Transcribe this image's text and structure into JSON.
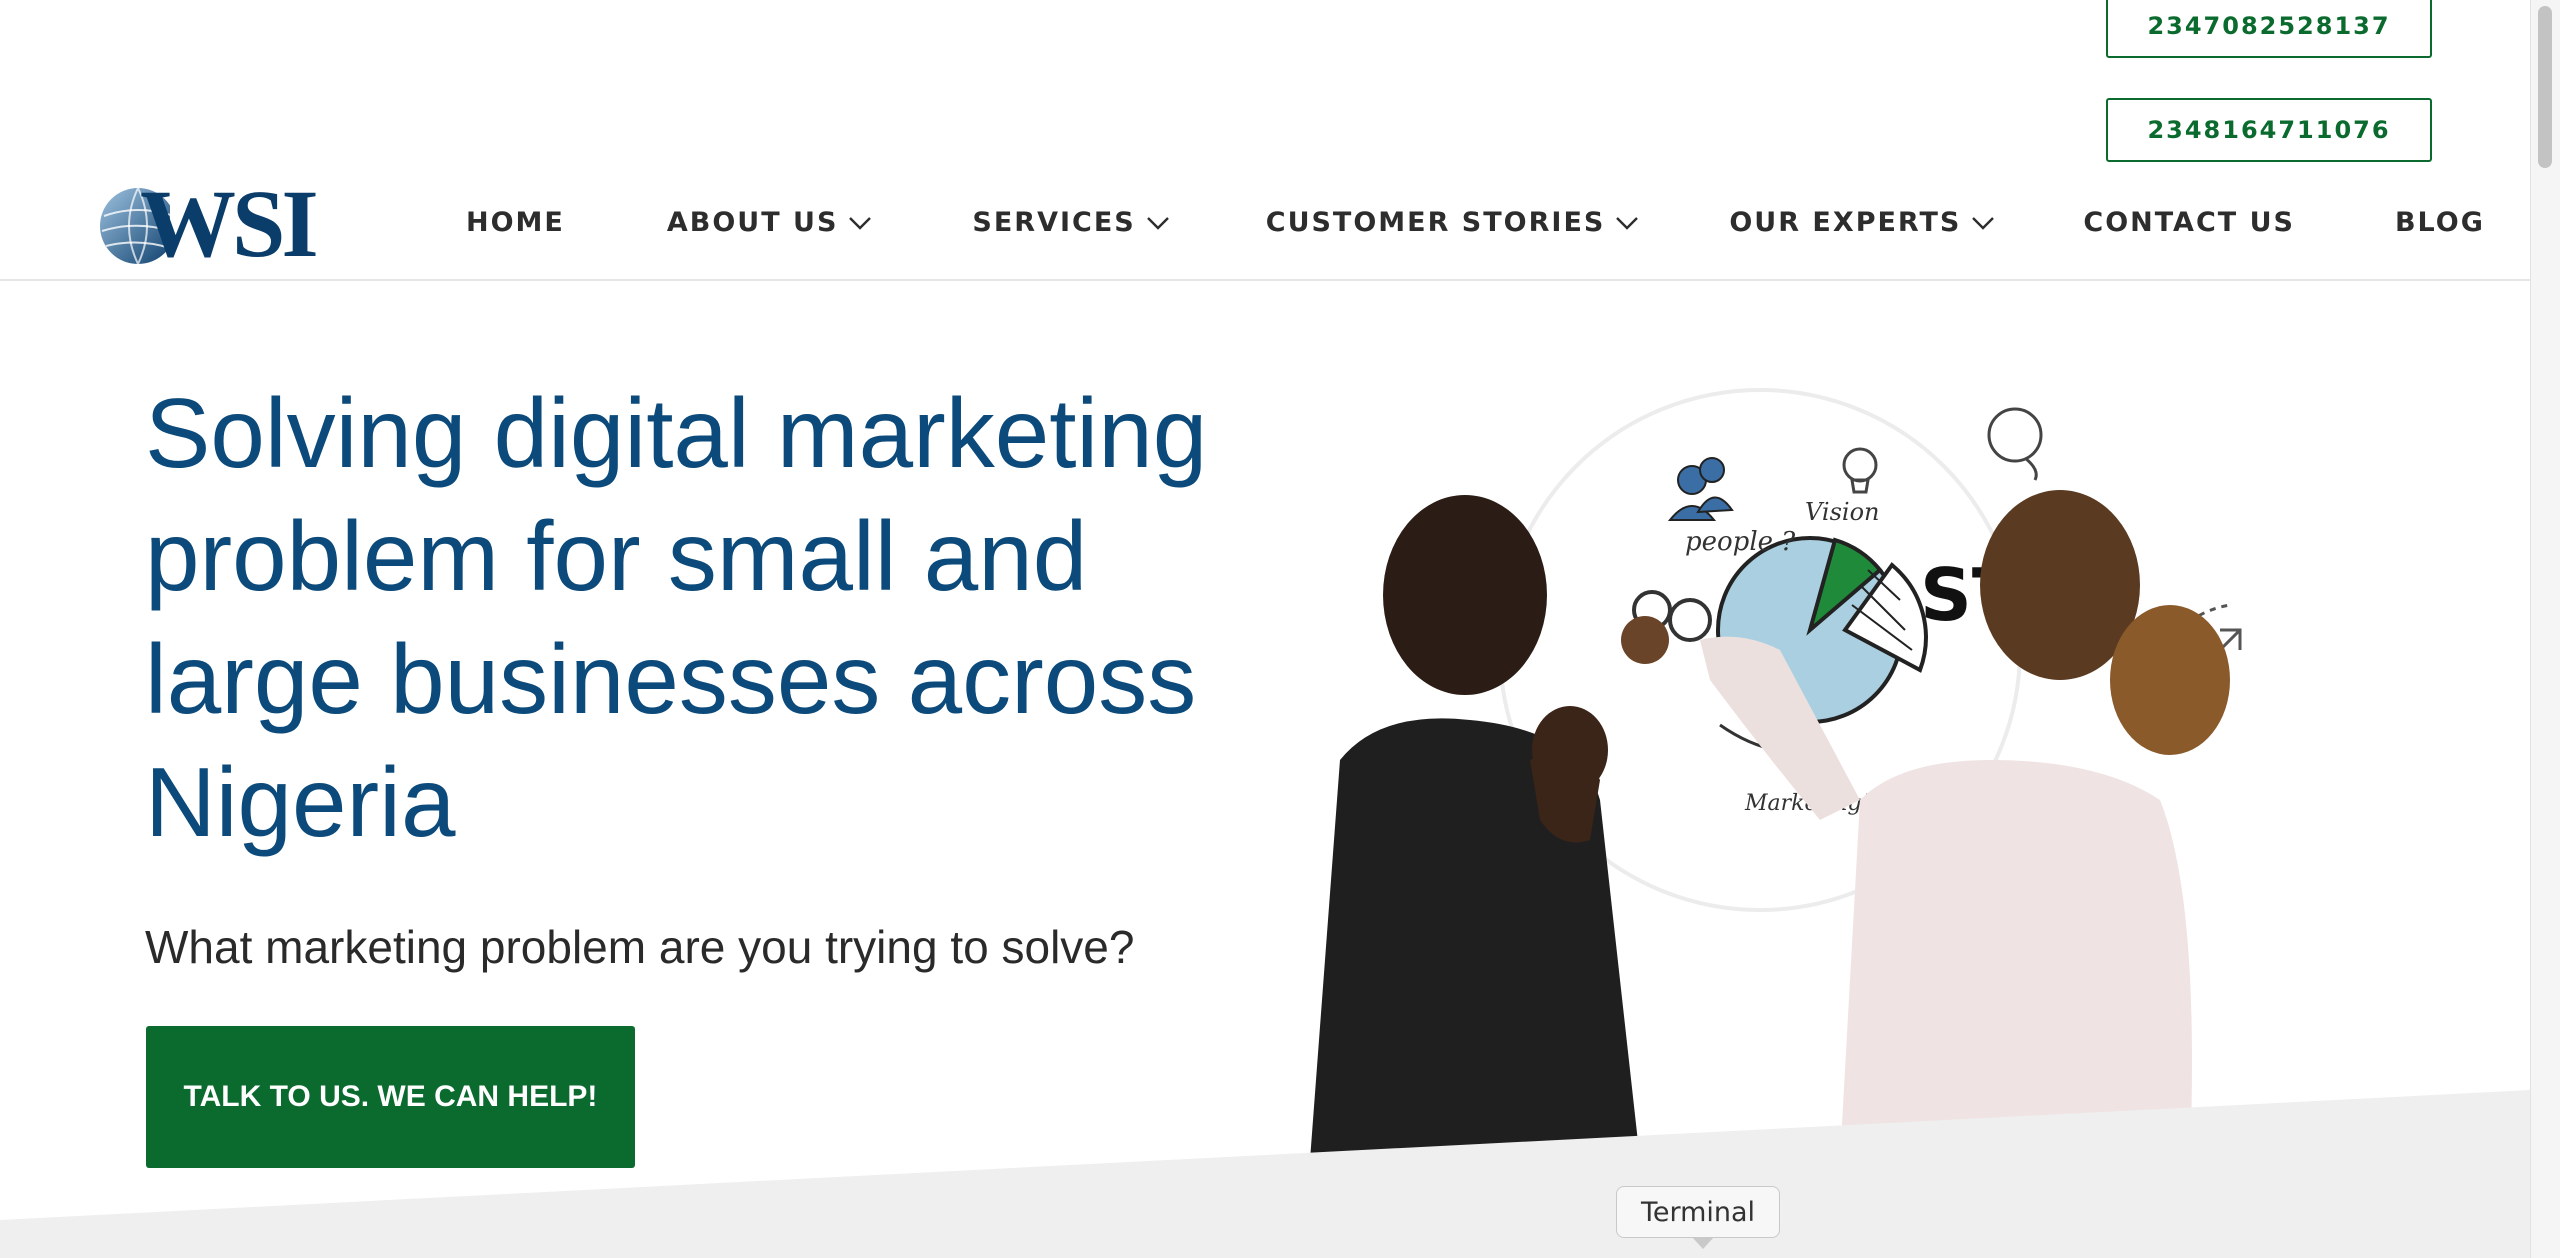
{
  "contact_buttons": [
    "2347082528137",
    "2348164711076"
  ],
  "header": {
    "logo_text": "WSI",
    "nav": {
      "home": "HOME",
      "about": "ABOUT US",
      "services": "SERVICES",
      "stories": "CUSTOMER STORIES",
      "experts": "OUR EXPERTS",
      "contact": "CONTACT US",
      "blog": "BLOG"
    }
  },
  "hero": {
    "headline": "Solving digital marketing problem for small and large businesses across Nigeria",
    "subheadline": "What marketing problem are you trying to solve?",
    "cta_label": "TALK TO US. WE CAN HELP!",
    "illustration_words": {
      "people": "people ?",
      "vision": "Vision",
      "strategy": "ST",
      "marketing": "Marketing!"
    }
  },
  "tooltip": {
    "label": "Terminal"
  },
  "colors": {
    "brand_blue": "#0b4a7a",
    "brand_green": "#0b6b2f",
    "text_dark": "#2d2d2d"
  }
}
